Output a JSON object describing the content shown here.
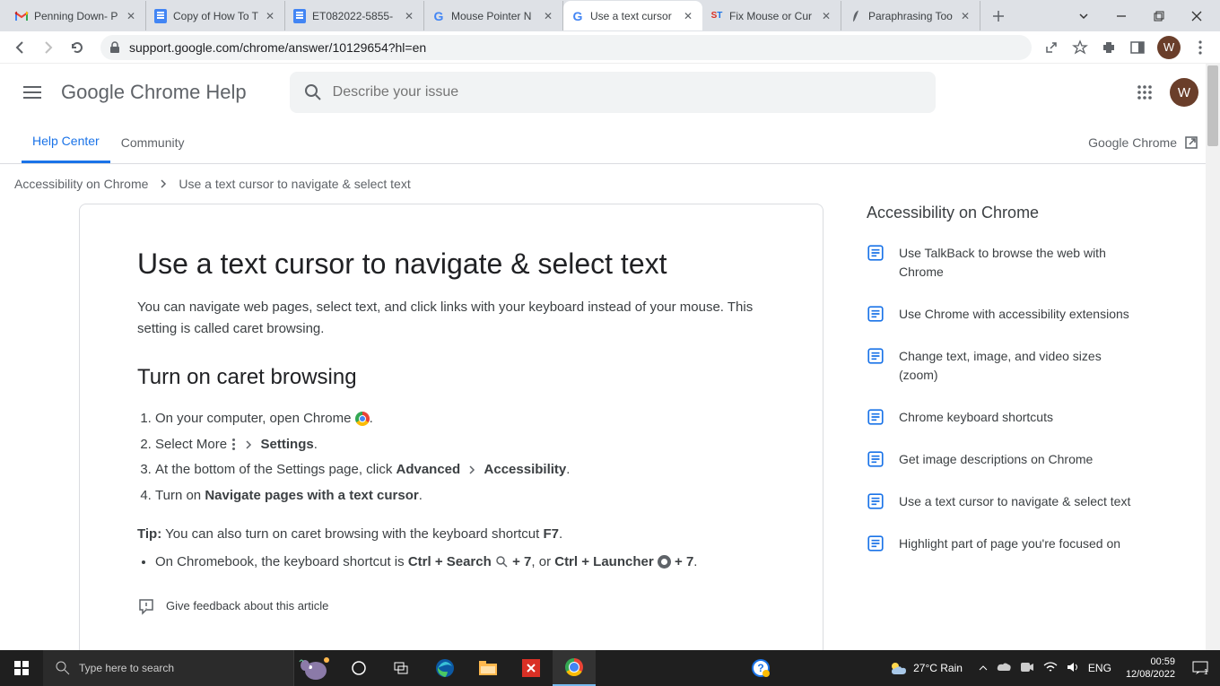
{
  "browser": {
    "tabs": [
      {
        "title": "Penning Down- P",
        "active": false
      },
      {
        "title": "Copy of How To T",
        "active": false
      },
      {
        "title": "ET082022-5855-",
        "active": false
      },
      {
        "title": "Mouse Pointer N",
        "active": false
      },
      {
        "title": "Use a text cursor",
        "active": true
      },
      {
        "title": "Fix Mouse or Cur",
        "active": false
      },
      {
        "title": "Paraphrasing Too",
        "active": false
      }
    ],
    "url": "support.google.com/chrome/answer/10129654?hl=en",
    "avatar_letter": "W"
  },
  "header": {
    "app_title": "Google Chrome Help",
    "search_placeholder": "Describe your issue"
  },
  "nav": {
    "help_center": "Help Center",
    "community": "Community",
    "product_link": "Google Chrome"
  },
  "breadcrumb": {
    "parent": "Accessibility on Chrome",
    "current": "Use a text cursor to navigate & select text"
  },
  "article": {
    "title": "Use a text cursor to navigate & select text",
    "intro": "You can navigate web pages, select text, and click links with your keyboard instead of your mouse. This setting is called caret browsing.",
    "section_heading": "Turn on caret browsing",
    "step1_a": "On your computer, open Chrome ",
    "step1_b": ".",
    "step2_a": "Select More ",
    "step2_b": "Settings",
    "step2_c": ".",
    "step3_a": "At the bottom of the Settings page, click ",
    "step3_b": "Advanced",
    "step3_c": "Accessibility",
    "step3_d": ".",
    "step4_a": "Turn on ",
    "step4_b": "Navigate pages with a text cursor",
    "step4_c": ".",
    "tip_label": "Tip:",
    "tip_text": " You can also turn on caret browsing with the keyboard shortcut ",
    "tip_key": "F7",
    "chromebook_a": "On Chromebook, the keyboard shortcut is ",
    "chromebook_b": "Ctrl + Search ",
    "chromebook_c": " + 7",
    "chromebook_d": ", or ",
    "chromebook_e": "Ctrl + Launcher ",
    "chromebook_f": " + 7",
    "chromebook_g": ".",
    "feedback": "Give feedback about this article"
  },
  "sidebar": {
    "heading": "Accessibility on Chrome",
    "items": [
      "Use TalkBack to browse the web with Chrome",
      "Use Chrome with accessibility extensions",
      "Change text, image, and video sizes (zoom)",
      "Chrome keyboard shortcuts",
      "Get image descriptions on Chrome",
      "Use a text cursor to navigate & select text",
      "Highlight part of page you're focused on"
    ]
  },
  "taskbar": {
    "search_placeholder": "Type here to search",
    "weather": "27°C  Rain",
    "lang": "ENG",
    "time": "00:59",
    "date": "12/08/2022"
  }
}
